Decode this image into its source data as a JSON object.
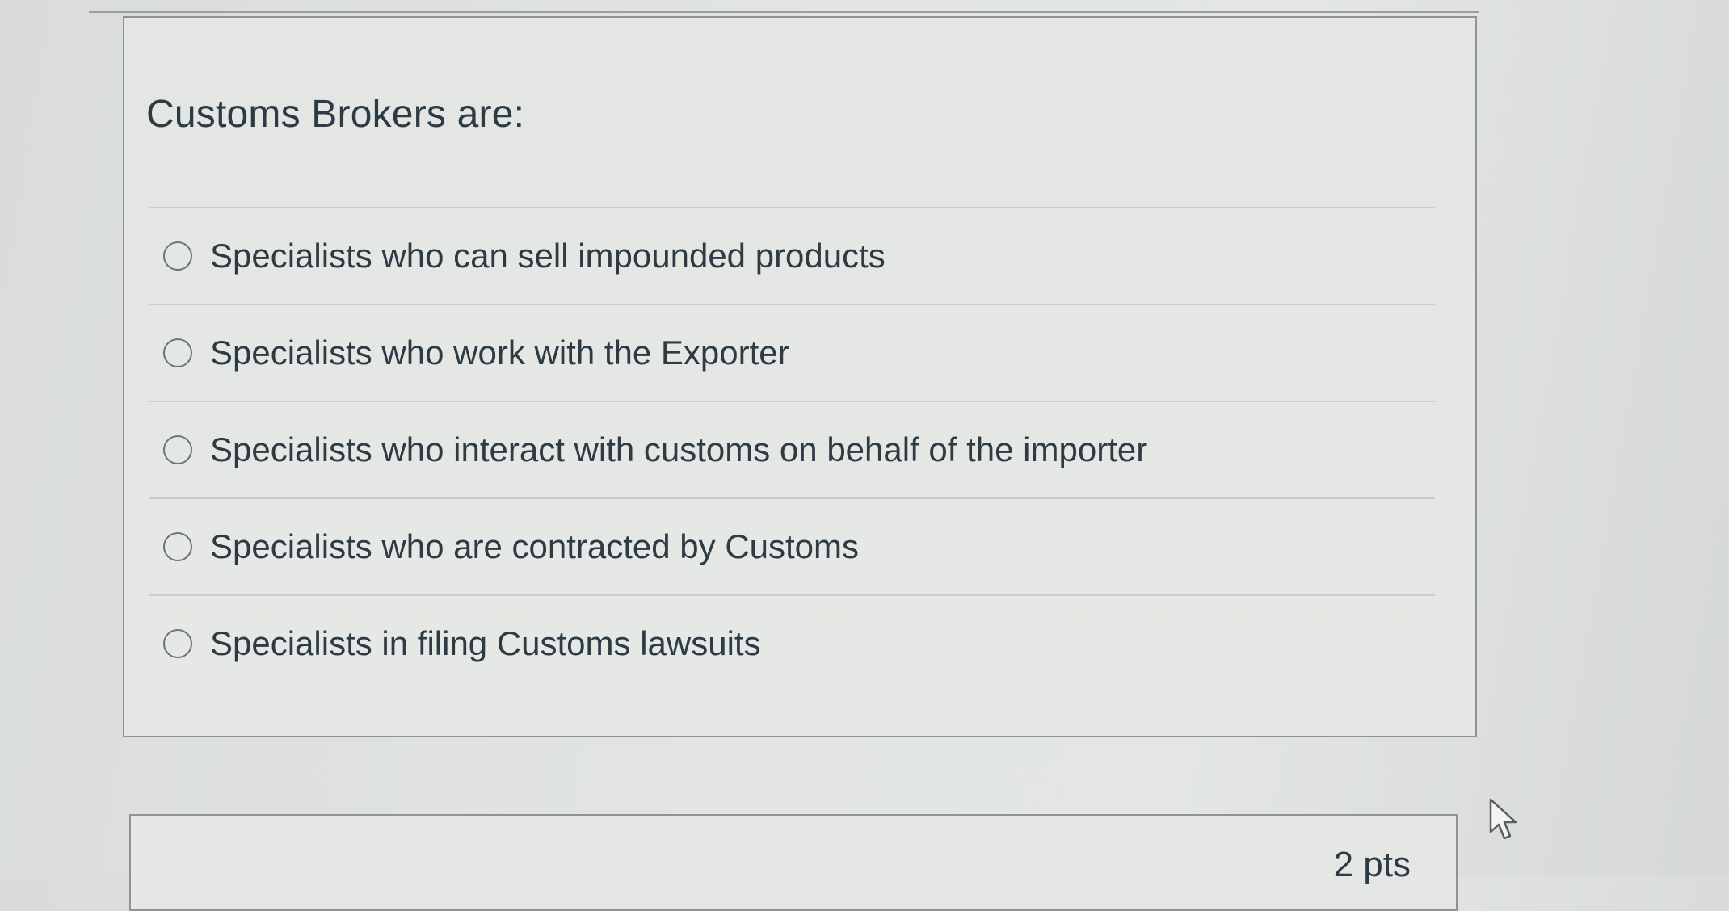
{
  "question": {
    "text": "Customs Brokers are:",
    "answers": [
      {
        "label": "Specialists who can sell impounded products",
        "selected": false
      },
      {
        "label": "Specialists who work with the Exporter",
        "selected": false
      },
      {
        "label": "Specialists who interact with customs on behalf of the importer",
        "selected": false
      },
      {
        "label": "Specialists who are contracted by Customs",
        "selected": false
      },
      {
        "label": "Specialists in filing Customs lawsuits",
        "selected": false
      }
    ]
  },
  "next_question": {
    "points": "2 pts"
  },
  "icons": {
    "cursor": "mouse-pointer-icon"
  }
}
